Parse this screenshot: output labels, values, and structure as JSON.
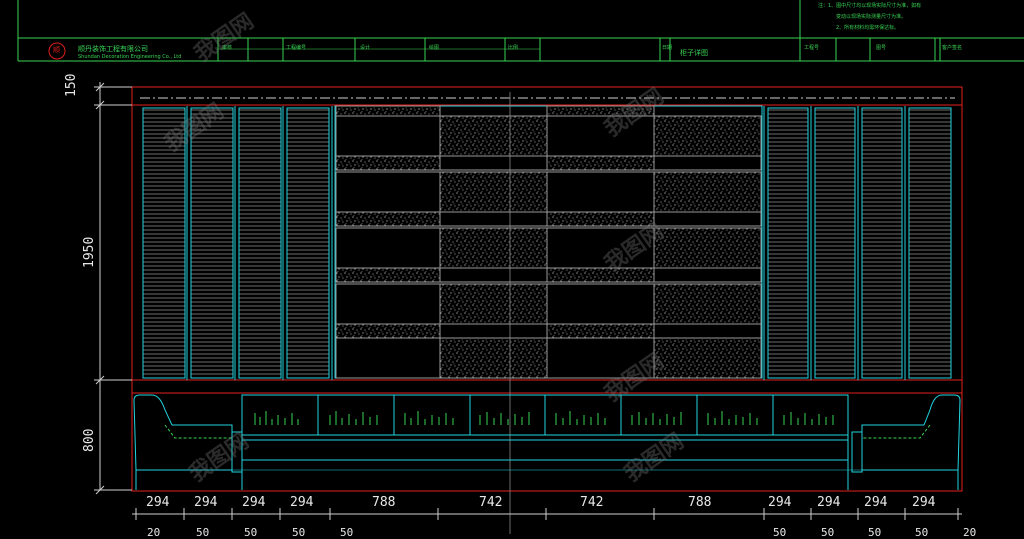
{
  "colors": {
    "background": "#000000",
    "cyan": "#21d4e0",
    "green": "#39d353",
    "red": "#e0201e",
    "white": "#e8e8e8",
    "gray": "#8a8a8a"
  },
  "title_block": {
    "company": "顺丹装饰工程有限公司",
    "company_en": "Shundan Decoration Engineering Co., Ltd",
    "logo_text": "顺",
    "fields": [
      "审核",
      "工程编号",
      "设计",
      "绘图",
      "比例",
      "日期",
      "柜子详图",
      "工程号",
      "图号",
      "客户签名"
    ],
    "notes": [
      "注：1、图中尺寸均以现场实际尺寸为准，如有",
      "变动以现场实际测量尺寸为准。",
      "2、所有材料均需环保达标。"
    ]
  },
  "dimensions": {
    "vertical": [
      "150",
      "1950",
      "800"
    ],
    "horizontal_top": [
      "294",
      "294",
      "294",
      "294",
      "788",
      "742",
      "742",
      "788",
      "294",
      "294",
      "294",
      "294"
    ],
    "horizontal_bottom": [
      "20",
      "50",
      "50",
      "50",
      "50",
      "50",
      "50",
      "50",
      "50",
      "20"
    ]
  },
  "watermark": "我图网"
}
